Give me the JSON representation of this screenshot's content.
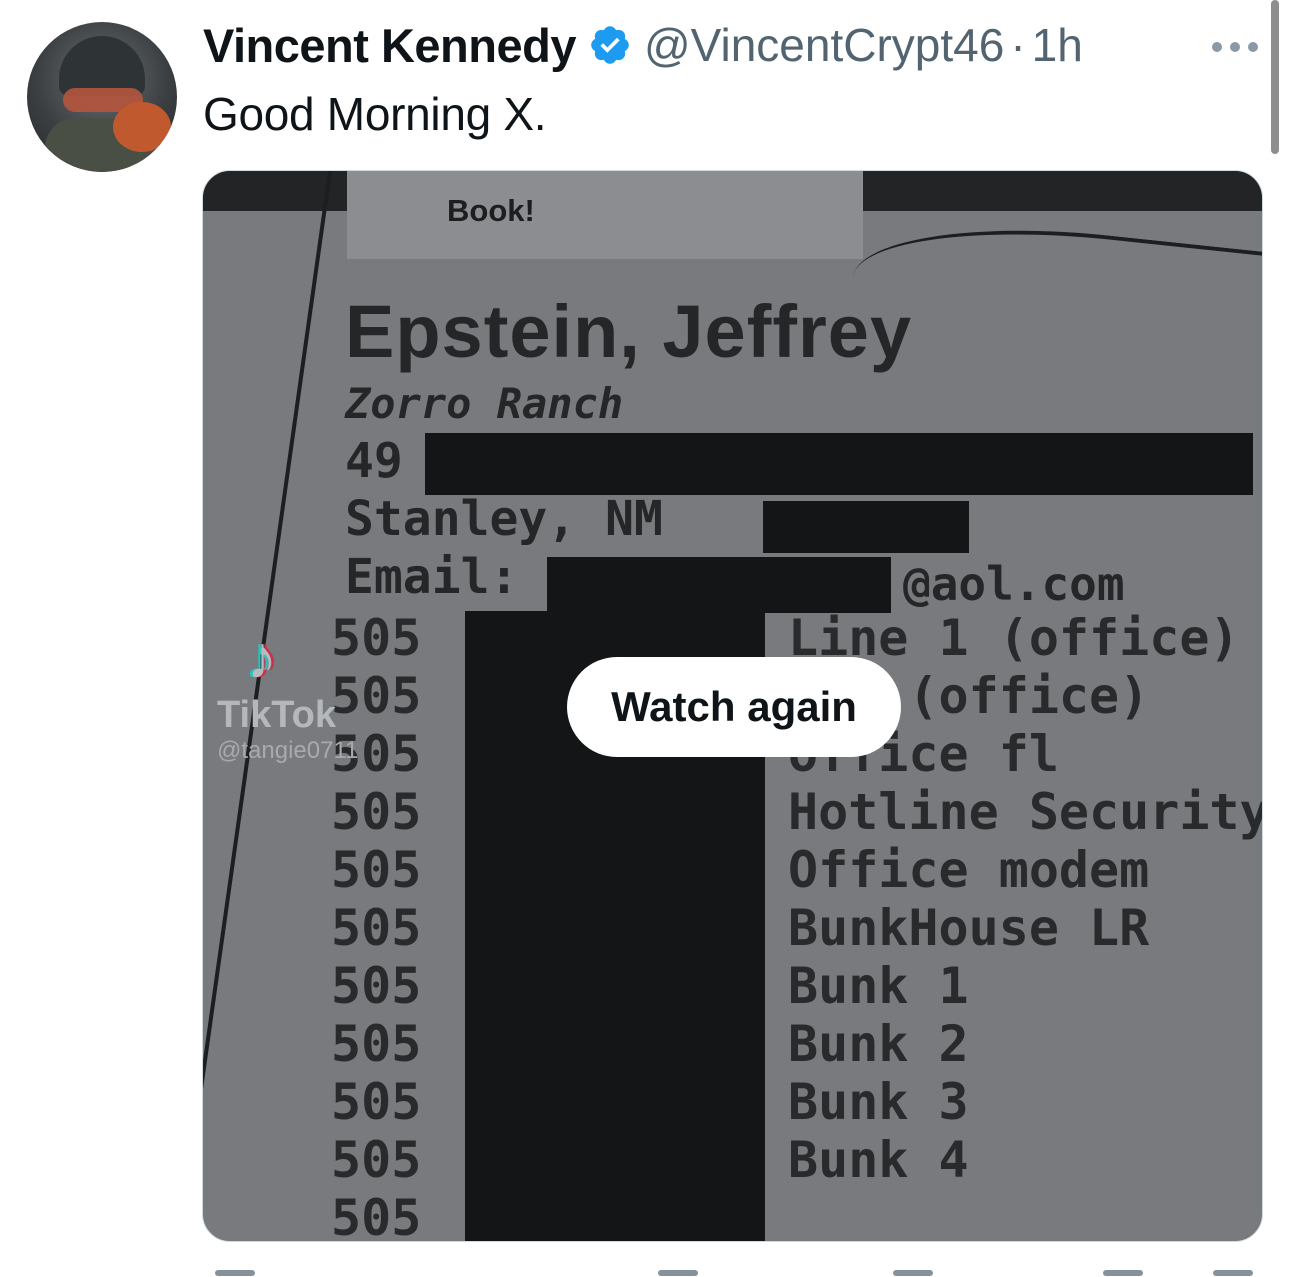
{
  "post": {
    "author_name": "Vincent Kennedy",
    "handle": "@VincentCrypt46",
    "separator": "·",
    "time": "1h",
    "text": "Good Morning X.",
    "colors": {
      "verified": "#1d9bf0",
      "secondary_text": "#536471"
    }
  },
  "media": {
    "card_text": "Book!",
    "doc_title": "Epstein, Jeffrey",
    "line_ranch": "Zorro Ranch",
    "line_addr": "49",
    "line_city": "Stanley, NM",
    "line_email_label": "Email:",
    "line_email_domain": "@aol.com",
    "phone_prefixes": [
      "505",
      "505",
      "505",
      "505",
      "505",
      "505",
      "505",
      "505",
      "505",
      "505",
      "505"
    ],
    "phone_labels": [
      "Line 1 (office)",
      "e 2 (office)",
      "office fl",
      "Hotline Security",
      "Office modem",
      "BunkHouse LR",
      "Bunk 1",
      "Bunk 2",
      "Bunk 3",
      "Bunk 4"
    ],
    "watermark": {
      "brand": "TikTok",
      "user": "@tangie0711"
    },
    "watch_again_label": "Watch again"
  },
  "icons": [
    "verified-badge-icon",
    "more-options-icon",
    "tiktok-logo-icon"
  ]
}
